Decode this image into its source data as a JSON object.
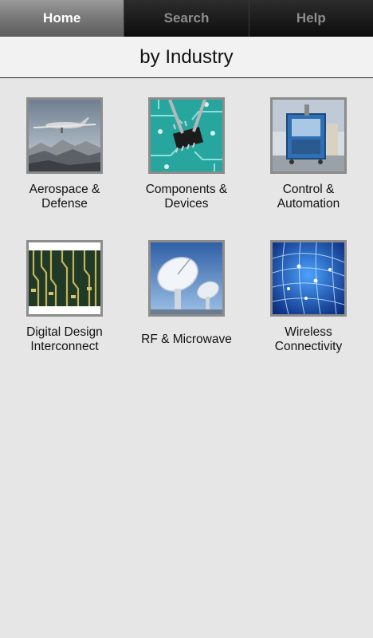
{
  "tabs": [
    {
      "label": "Home",
      "active": true
    },
    {
      "label": "Search",
      "active": false
    },
    {
      "label": "Help",
      "active": false
    }
  ],
  "header": {
    "title": "by Industry"
  },
  "industries": [
    {
      "line1": "Aerospace &",
      "line2": "Defense",
      "icon": "aerospace-drone-icon"
    },
    {
      "line1": "Components &",
      "line2": "Devices",
      "icon": "circuit-chip-icon"
    },
    {
      "line1": "Control &",
      "line2": "Automation",
      "icon": "automation-machine-icon"
    },
    {
      "line1": "Digital Design",
      "line2": "Interconnect",
      "icon": "pcb-traces-icon"
    },
    {
      "line1": "RF & Microwave",
      "line2": "",
      "icon": "satellite-dish-icon"
    },
    {
      "line1": "Wireless",
      "line2": "Connectivity",
      "icon": "wireless-mesh-icon"
    }
  ]
}
